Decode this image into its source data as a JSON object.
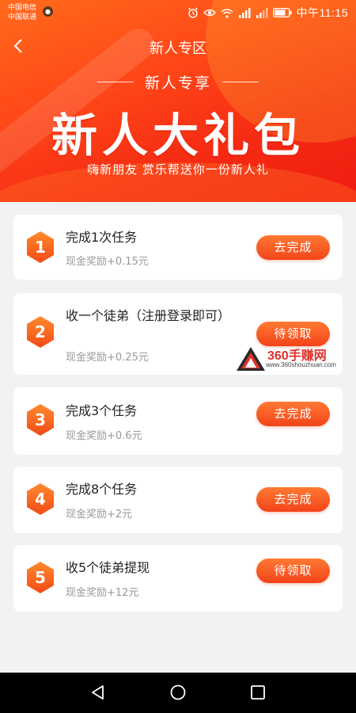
{
  "status_bar": {
    "carrier1": "中国电信",
    "carrier2": "中国联通",
    "time": "中午11:15"
  },
  "header": {
    "title": "新人专区",
    "subtitle": "新人专享",
    "hero_title": "新人大礼包",
    "hero_subtitle": "嗨新朋友 赏乐帮送你一份新人礼"
  },
  "tasks": [
    {
      "num": "1",
      "title": "完成1次任务",
      "reward": "现金奖励+0.15元",
      "button": "去完成"
    },
    {
      "num": "2",
      "title": "收一个徒弟（注册登录即可）",
      "reward": "现金奖励+0.25元",
      "button": "待领取"
    },
    {
      "num": "3",
      "title": "完成3个任务",
      "reward": "现金奖励+0.6元",
      "button": "去完成"
    },
    {
      "num": "4",
      "title": "完成8个任务",
      "reward": "现金奖励+2元",
      "button": "去完成"
    },
    {
      "num": "5",
      "title": "收5个徒弟提现",
      "reward": "现金奖励+12元",
      "button": "待领取"
    }
  ],
  "watermark": {
    "brand": "360手赚网",
    "url": "www.360shouzhuan.com"
  },
  "icons": {
    "back": "chevron-left-icon",
    "nav": [
      "back-triangle-icon",
      "home-circle-icon",
      "recents-square-icon"
    ]
  },
  "colors": {
    "accent": "#f2431a",
    "banner": "#ff4a18"
  }
}
